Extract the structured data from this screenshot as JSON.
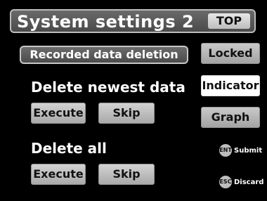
{
  "header": {
    "title": "System settings 2",
    "top_label": "TOP"
  },
  "section": {
    "title": "Recorded data deletion"
  },
  "rows": [
    {
      "label": "Delete newest data",
      "execute_label": "Execute",
      "skip_label": "Skip"
    },
    {
      "label": "Delete all",
      "execute_label": "Execute",
      "skip_label": "Skip"
    }
  ],
  "side_buttons": [
    {
      "label": "Locked",
      "active": false
    },
    {
      "label": "Indicator",
      "active": true
    },
    {
      "label": "Graph",
      "active": false
    }
  ],
  "keys": [
    {
      "icon": "ENT",
      "label": "Submit"
    },
    {
      "icon": "ESC",
      "label": "Discard"
    }
  ],
  "colors": {
    "background": "#000000",
    "button_gray": "#BDBDBD",
    "active_button": "#FFFFFF"
  }
}
